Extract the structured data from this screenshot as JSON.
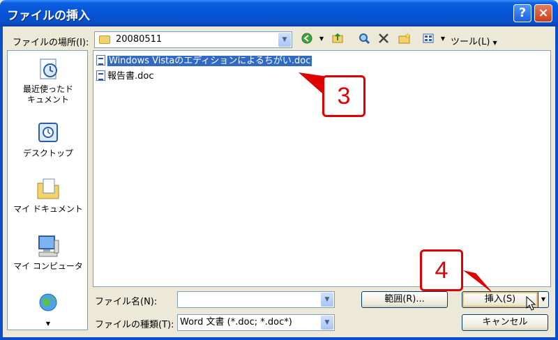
{
  "window": {
    "title": "ファイルの挿入",
    "help_glyph": "?",
    "close_glyph": "×"
  },
  "location": {
    "label": "ファイルの場所(I):",
    "value": "20080511"
  },
  "toolbar": {
    "tools_label": "ツール(L)",
    "icons": [
      "back-icon",
      "up-folder-icon",
      "search-web-icon",
      "delete-icon",
      "new-folder-icon",
      "views-icon"
    ]
  },
  "places": [
    {
      "label": "最近使ったド\nキュメント",
      "icon": "recent-documents-icon"
    },
    {
      "label": "デスクトップ",
      "icon": "desktop-icon"
    },
    {
      "label": "マイ ドキュメント",
      "icon": "my-documents-icon"
    },
    {
      "label": "マイ コンピュータ",
      "icon": "my-computer-icon"
    },
    {
      "label": "",
      "icon": "network-places-icon"
    }
  ],
  "files": [
    {
      "name": "Windows Vistaのエディションによるちがい.doc",
      "selected": true
    },
    {
      "name": "報告書.doc",
      "selected": false
    }
  ],
  "callouts": {
    "step3": "3",
    "step4": "4"
  },
  "filename": {
    "label": "ファイル名(N):",
    "value": ""
  },
  "filetype": {
    "label": "ファイルの種類(T):",
    "value": "Word 文書 (*.doc; *.doc*)"
  },
  "buttons": {
    "range": "範囲(R)...",
    "insert": "挿入(S)",
    "cancel": "キャンセル"
  },
  "colors": {
    "titlebar": "#0454d6",
    "selection": "#316ac5",
    "callout": "#e00000"
  }
}
